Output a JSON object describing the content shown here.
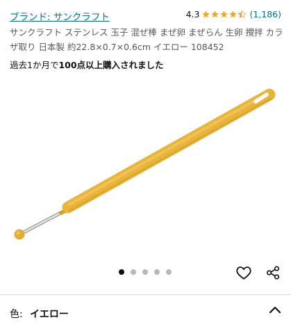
{
  "brand": {
    "label": "ブランド: サンクラフト"
  },
  "rating": {
    "value": "4.3",
    "stars": 4.3,
    "count": "(1,186)"
  },
  "product": {
    "title": "サンクラフト ステンレス 玉子 混ぜ棒 まぜ卵 まぜらん 生卵 攪拌 カラザ取り 日本製 約22.8×0.7×0.6cm イエロー 108452",
    "bought_prefix": "過去1か月で",
    "bought_emphasis": "100点以上購入されました"
  },
  "gallery": {
    "image_count": 5,
    "active_index": 0
  },
  "icons": {
    "favorite": "heart-icon",
    "share": "share-icon",
    "collapse": "chevron-up-icon"
  },
  "variation": {
    "label": "色:",
    "value": "イエロー"
  },
  "colors": {
    "link": "#007185",
    "star": "#f5a623",
    "product_yellow": "#e8b43a"
  }
}
